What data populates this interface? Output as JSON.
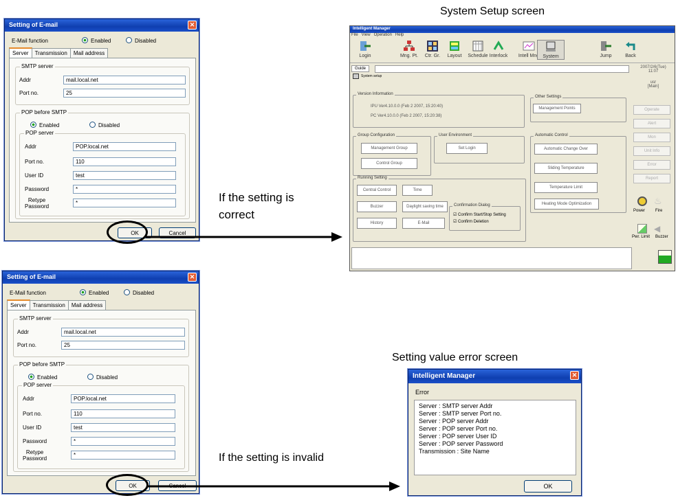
{
  "captions": {
    "system_setup": "System Setup screen",
    "correct": "If the setting is\ncorrect",
    "error_screen": "Setting value error screen",
    "invalid": "If the setting is invalid"
  },
  "email_dialog": {
    "title": "Setting of E-mail",
    "function_label": "E-Mail function",
    "enabled": "Enabled",
    "disabled": "Disabled",
    "tabs": [
      "Server",
      "Transmission",
      "Mail address"
    ],
    "smtp_group": "SMTP server",
    "addr_label": "Addr",
    "smtp_addr": "mail.local.net",
    "port_label": "Port no.",
    "smtp_port": "25",
    "pop_before_group": "POP before SMTP",
    "pop_server_group": "POP server",
    "pop_addr": "POP.local.net",
    "pop_port": "110",
    "user_id_label": "User ID",
    "user_id": "test",
    "password_label": "Password",
    "password": "*",
    "retype_label": "Retype\nPassword",
    "retype": "*",
    "ok": "OK",
    "cancel": "Cancel"
  },
  "system_setup": {
    "title": "Intelligent Manager",
    "menu": "File   View   Operation   Help",
    "toolbar": [
      "Login",
      "Mng. Pt.",
      "Ctr. Gr.",
      "Layout",
      "Schedule",
      "Interlock",
      "Intell Mng",
      "System",
      "Jump",
      "Back"
    ],
    "guide": "Guide",
    "datetime": "2007/2/6(Tue)\n11:07",
    "user": "usr\n[Main]",
    "screen_label": "System setup",
    "version_group": "Version Information",
    "version_line1": "IPU Ver4.10.0.0 (Feb 2 2007, 15:20:40)",
    "version_line2": "PC Ver4.10.0.0 (Feb 2 2007, 15:20:38)",
    "other_group": "Other Settings",
    "mgmt_points": "Management Points",
    "group_config": "Group Configuration",
    "mgmt_group": "Management Group",
    "control_group": "Control Group",
    "user_env": "User Environment",
    "set_login": "Set Login",
    "auto_control": "Automatic Control",
    "auto_change": "Automatic Change Over",
    "sliding_temp": "Sliding Temperature",
    "temp_limit": "Temperature Limit",
    "heating_opt": "Heating Mode Optimization",
    "running": "Running Setting",
    "central": "Central Control",
    "time": "Time",
    "buzzer_btn": "Buzzer",
    "daylight": "Daylight saving time",
    "history": "History",
    "email": "E-Mail",
    "confirm_group": "Confirmation Dialog",
    "confirm1": "Confirm Start/Stop Setting",
    "confirm2": "Confirm Deletion",
    "side": [
      "Operate",
      "Alert",
      "Mon",
      "Unit Info",
      "Error",
      "Report"
    ],
    "bottom_icons": [
      "Power",
      "Fire",
      "Pwr. Limit",
      "Buzzer"
    ]
  },
  "error_dialog": {
    "title": "Intelligent Manager",
    "heading": "Error",
    "lines": [
      "Server : SMTP server Addr",
      "Server : SMTP server Port no.",
      "Server : POP server Addr",
      "Server : POP server Port no.",
      "Server : POP server User ID",
      "Server : POP server Password",
      "Transmission : Site Name"
    ],
    "ok": "OK"
  }
}
